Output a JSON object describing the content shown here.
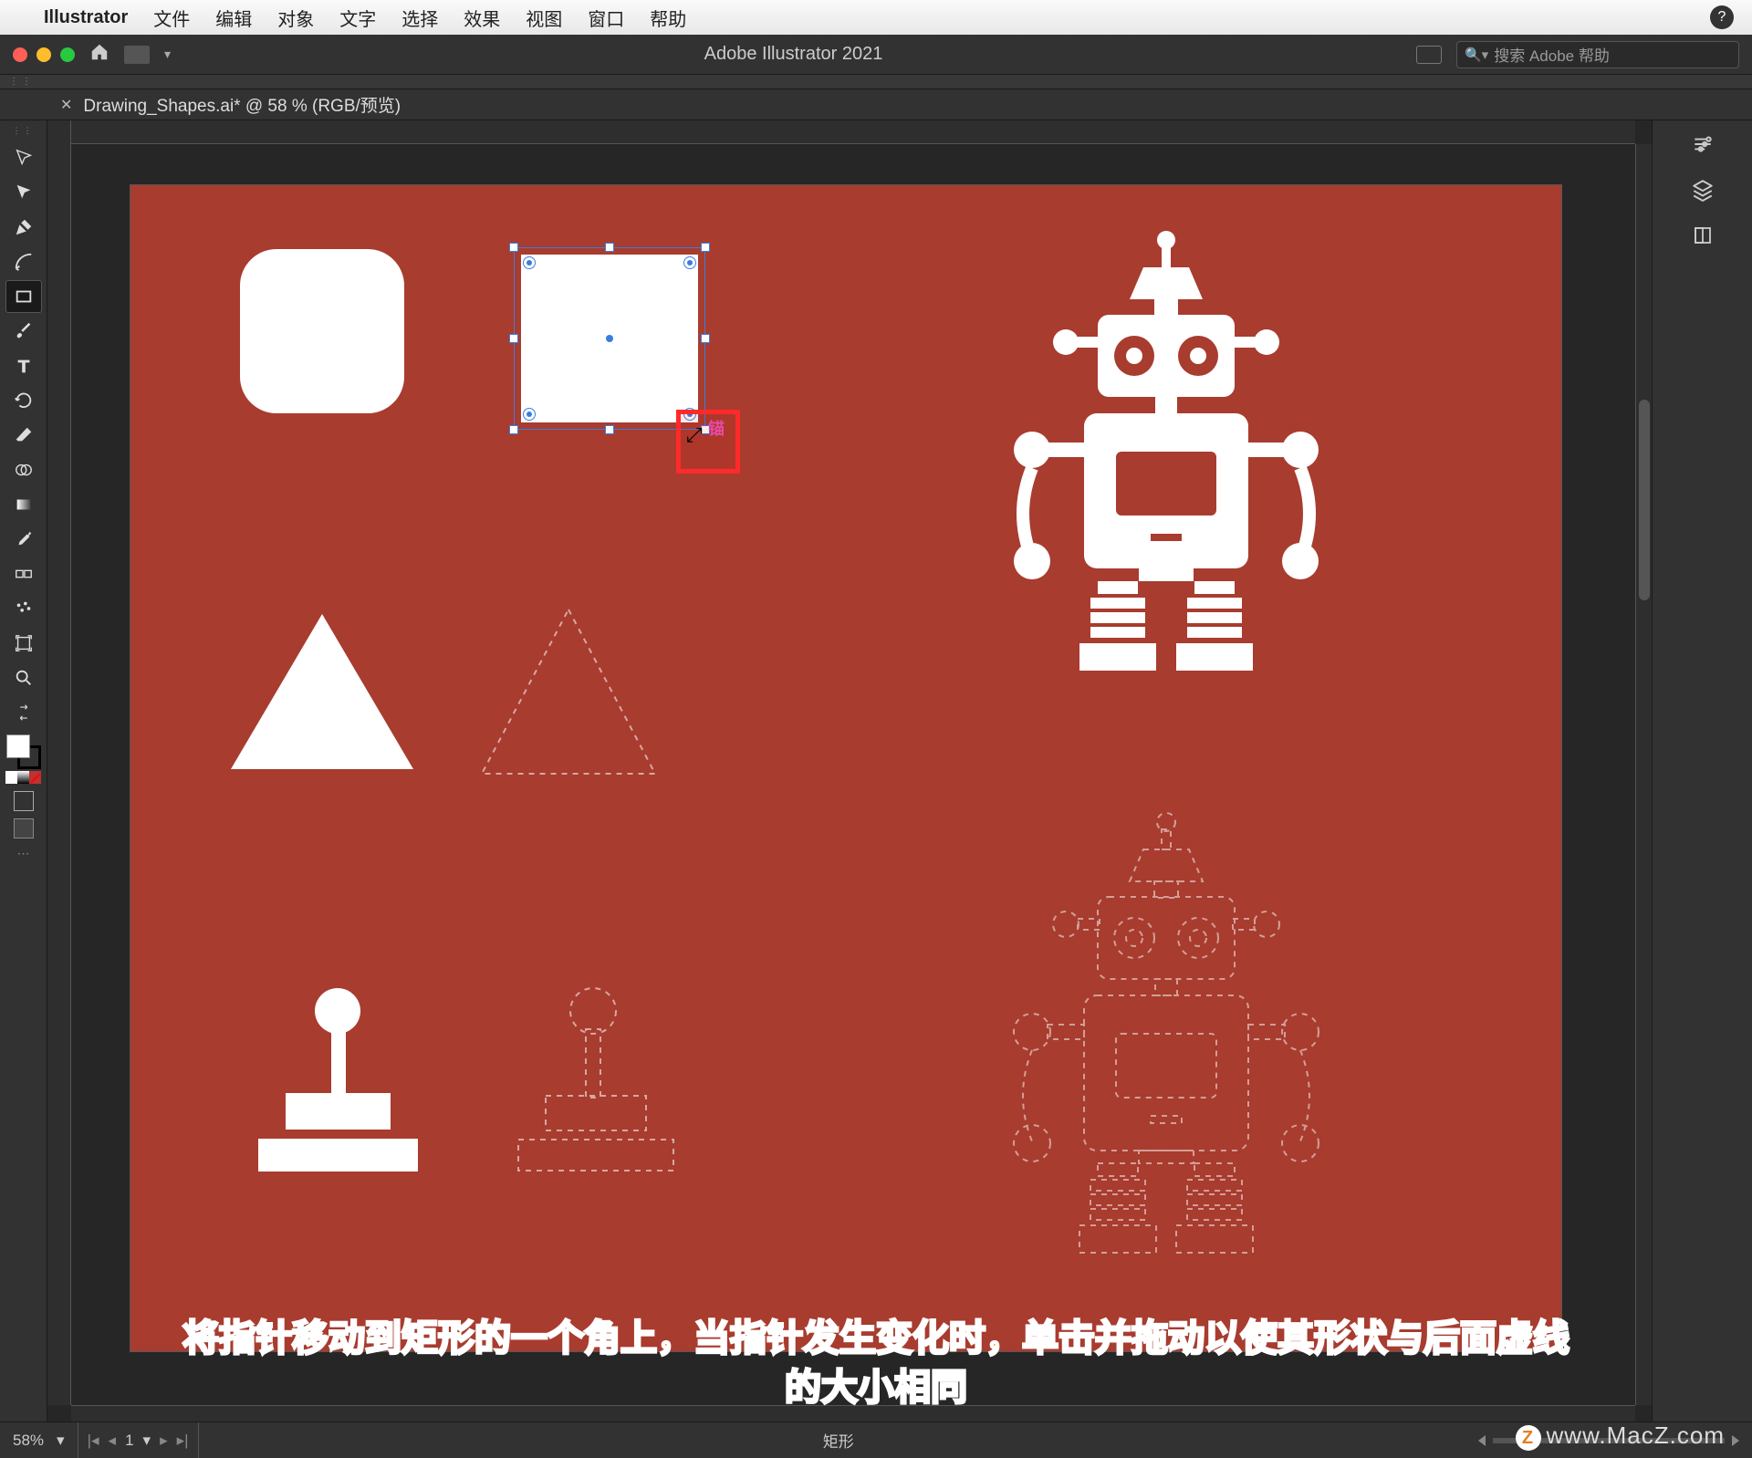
{
  "mac_menu": {
    "app": "Illustrator",
    "items": [
      "文件",
      "编辑",
      "对象",
      "文字",
      "选择",
      "效果",
      "视图",
      "窗口",
      "帮助"
    ]
  },
  "titlebar": {
    "app_title": "Adobe Illustrator 2021",
    "search_placeholder": "搜索 Adobe 帮助"
  },
  "document": {
    "tab_label": "Drawing_Shapes.ai* @ 58 % (RGB/预览)"
  },
  "status": {
    "zoom": "58%",
    "artboard_num": "1",
    "tool_name": "矩形"
  },
  "cursor_hint": "锚",
  "caption": {
    "line1": "将指针移动到矩形的一个角上，当指针发生变化时，单击并拖动以使其形状与后面虚线",
    "line2": "的大小相同"
  },
  "watermark": "www.MacZ.com",
  "colors": {
    "artboard_bg": "#a83c2f",
    "selection": "#3a7de0",
    "highlight": "#ff2a2a"
  },
  "tools": [
    "selection",
    "direct-selection",
    "pen",
    "curvature",
    "rectangle",
    "paintbrush",
    "type",
    "rotate",
    "eraser",
    "shape-builder",
    "gradient",
    "eyedropper",
    "blend",
    "symbol-sprayer",
    "artboard",
    "zoom"
  ],
  "right_panels": [
    "properties",
    "layers",
    "libraries"
  ]
}
